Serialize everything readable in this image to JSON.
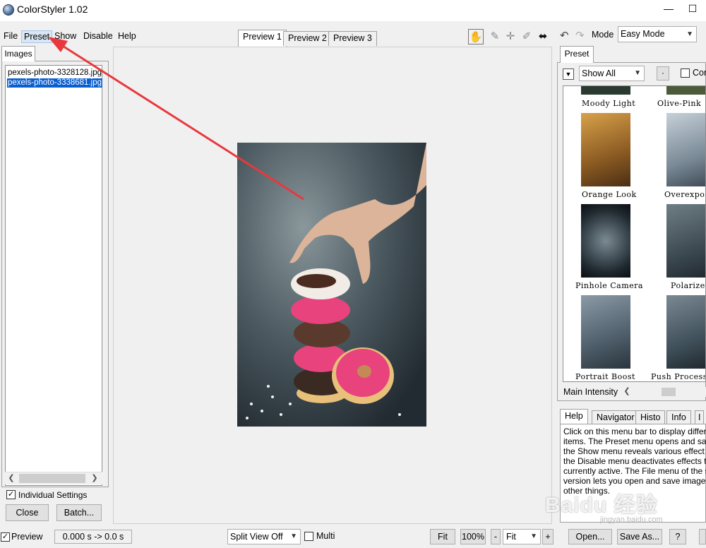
{
  "window": {
    "title": "ColorStyler 1.02",
    "min_label": "—",
    "max_label": "☐"
  },
  "menu": [
    "File",
    "Preset",
    "Show",
    "Disable",
    "Help"
  ],
  "preview_tabs": [
    "Preview 1",
    "Preview 2",
    "Preview 3"
  ],
  "left_panel": {
    "tab": "Images",
    "files": [
      "pexels-photo-3328128.jpg",
      "pexels-photo-3338681.jpg"
    ],
    "selected_index": 1,
    "individual_settings_label": "Individual Settings",
    "individual_settings_checked": true,
    "close_label": "Close",
    "batch_label": "Batch..."
  },
  "right_panel": {
    "mode_label": "Mode",
    "mode_value": "Easy Mode",
    "preset_tab": "Preset",
    "show_all_value": "Show All",
    "dot_label": "·",
    "com_label": "Com",
    "presets": [
      "Moody Light",
      "Olive-Pink",
      "Orange Look",
      "Overexpos",
      "Pinhole Camera",
      "Polarize",
      "Portrait Boost",
      "Push Process"
    ],
    "intensity_label": "Main Intensity"
  },
  "help_panel": {
    "tabs": [
      "Help",
      "Navigator",
      "Histo",
      "Info",
      "I"
    ],
    "text": "Click on this menu bar to display differen\nitems. The Preset menu opens and save\nthe Show menu reveals various effect c\nthe Disable menu deactivates effects th\ncurrently active. The File menu of the sta\nversion lets you open and save image fil\nother things."
  },
  "status_bar": {
    "preview_label": "Preview",
    "preview_checked": true,
    "time_text": "0.000 s -> 0.0 s",
    "split_value": "Split View Off",
    "multi_label": "Multi",
    "fit_label": "Fit",
    "zoom_label": "100%",
    "minus_label": "-",
    "fit_select_value": "Fit",
    "plus_label": "+",
    "open_label": "Open...",
    "save_label": "Save As...",
    "help_label": "?"
  },
  "watermark": {
    "main": "Baidu 经验",
    "sub": "jingyan.baidu.com"
  },
  "colors": {
    "selection": "#0a5fd0",
    "arrow": "#e8383d"
  }
}
